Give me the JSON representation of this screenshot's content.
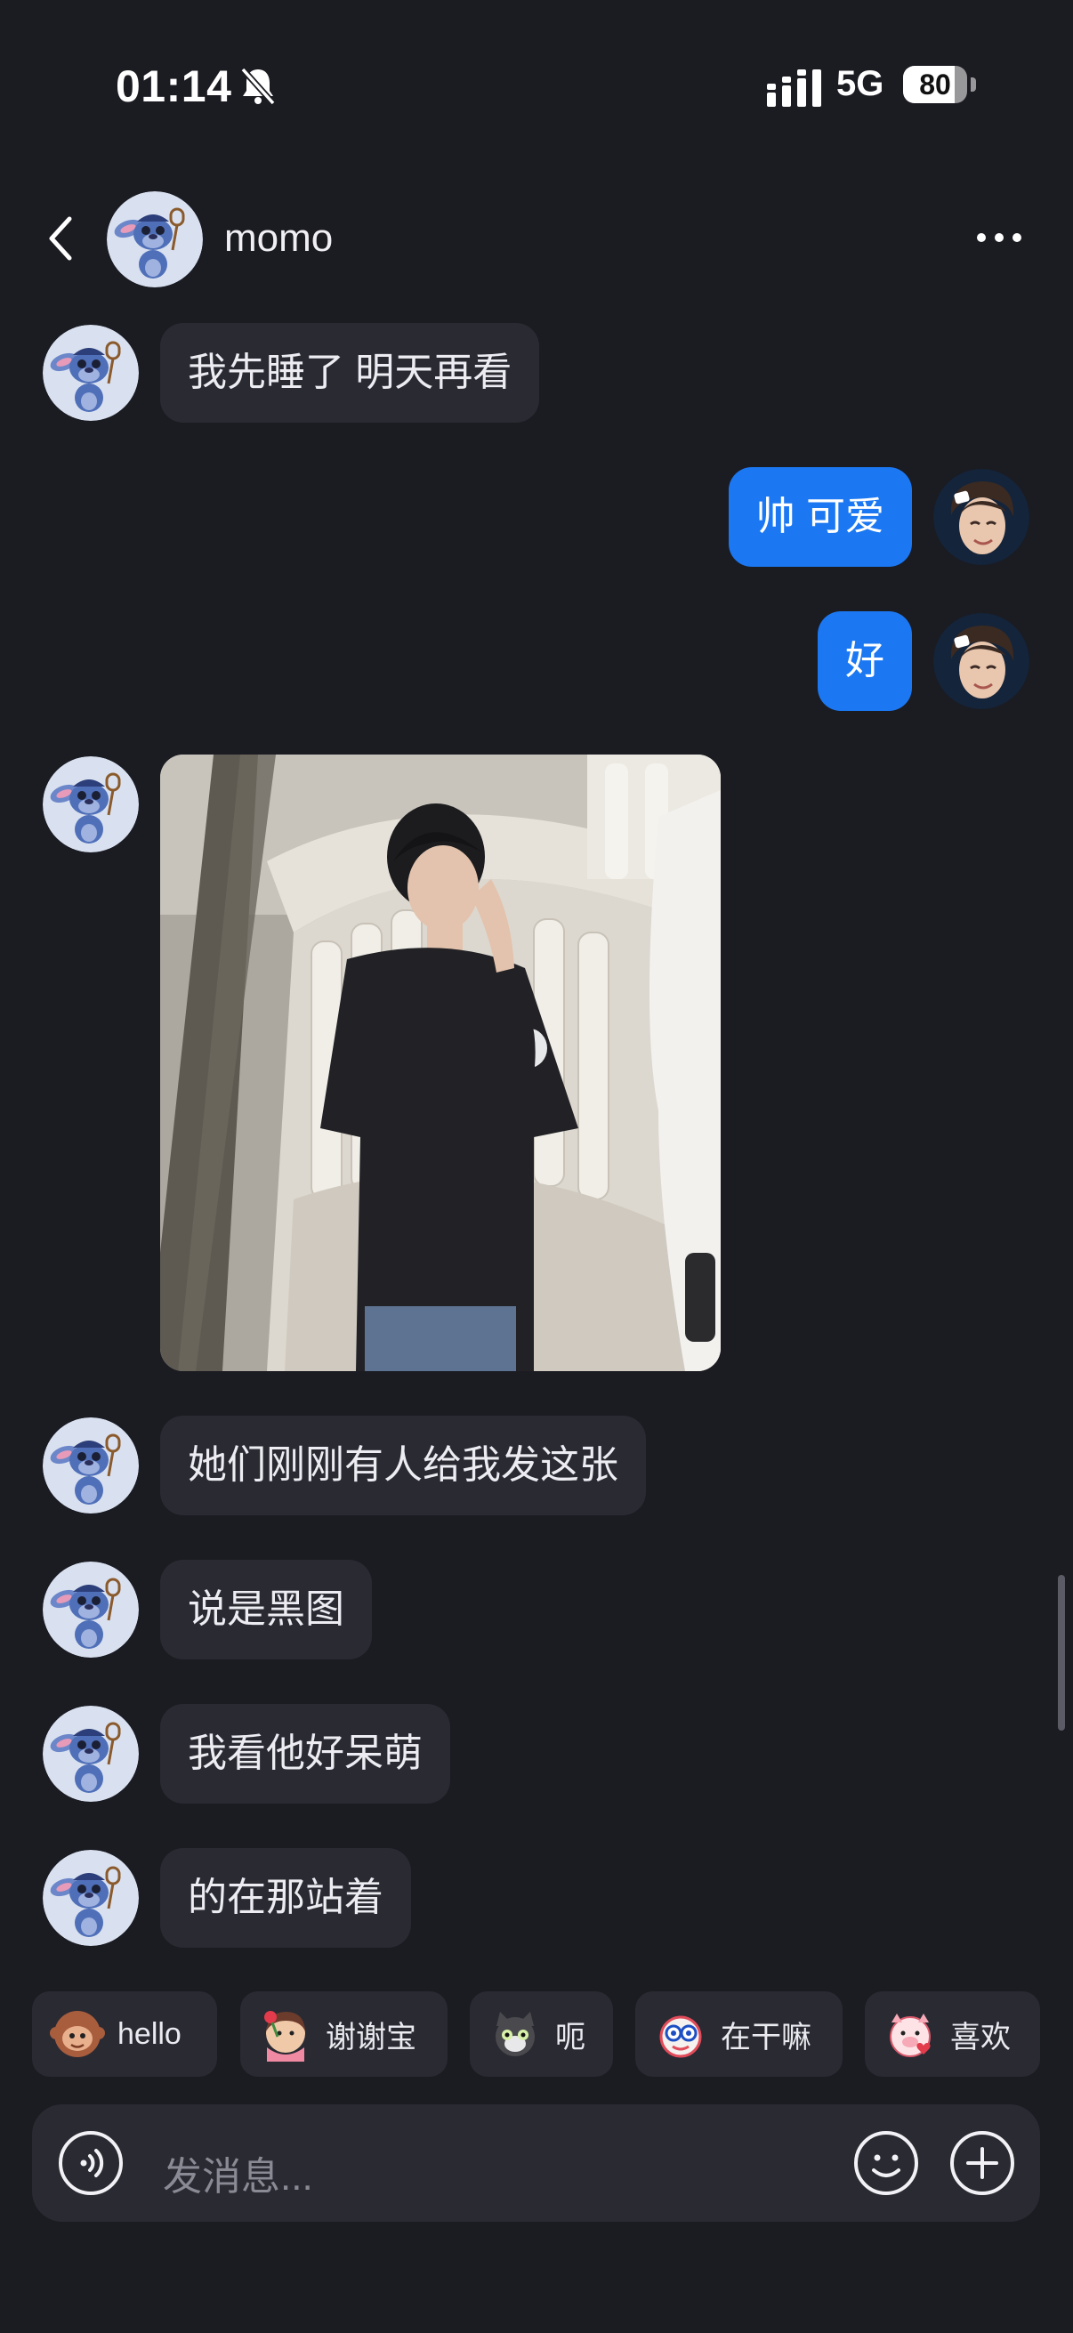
{
  "status_bar": {
    "time": "01:14",
    "network": "5G",
    "battery_level": "80",
    "battery_fraction": 0.8
  },
  "header": {
    "contact_name": "momo"
  },
  "messages": [
    {
      "side": "in",
      "text": "我先睡了 明天再看"
    },
    {
      "side": "out",
      "text": "帅 可爱"
    },
    {
      "side": "out",
      "text": "好"
    },
    {
      "side": "in",
      "type": "image"
    },
    {
      "side": "in",
      "text": "她们刚刚有人给我发这张"
    },
    {
      "side": "in",
      "text": "说是黑图"
    },
    {
      "side": "in",
      "text": "我看他好呆萌"
    },
    {
      "side": "in",
      "text": "的在那站着"
    }
  ],
  "quick_replies": [
    {
      "label": "hello",
      "icon": "monkey-sticker-icon"
    },
    {
      "label": "谢谢宝",
      "icon": "girl-flower-sticker-icon"
    },
    {
      "label": "呃",
      "icon": "cat-sticker-icon"
    },
    {
      "label": "在干嘛",
      "icon": "peeking-sticker-icon"
    },
    {
      "label": "喜欢",
      "icon": "pig-heart-sticker-icon"
    }
  ],
  "composer": {
    "placeholder": "发消息..."
  },
  "colors": {
    "background": "#1b1b22",
    "bubble_in": "#2a2a33",
    "bubble_out": "#1b78f2"
  }
}
